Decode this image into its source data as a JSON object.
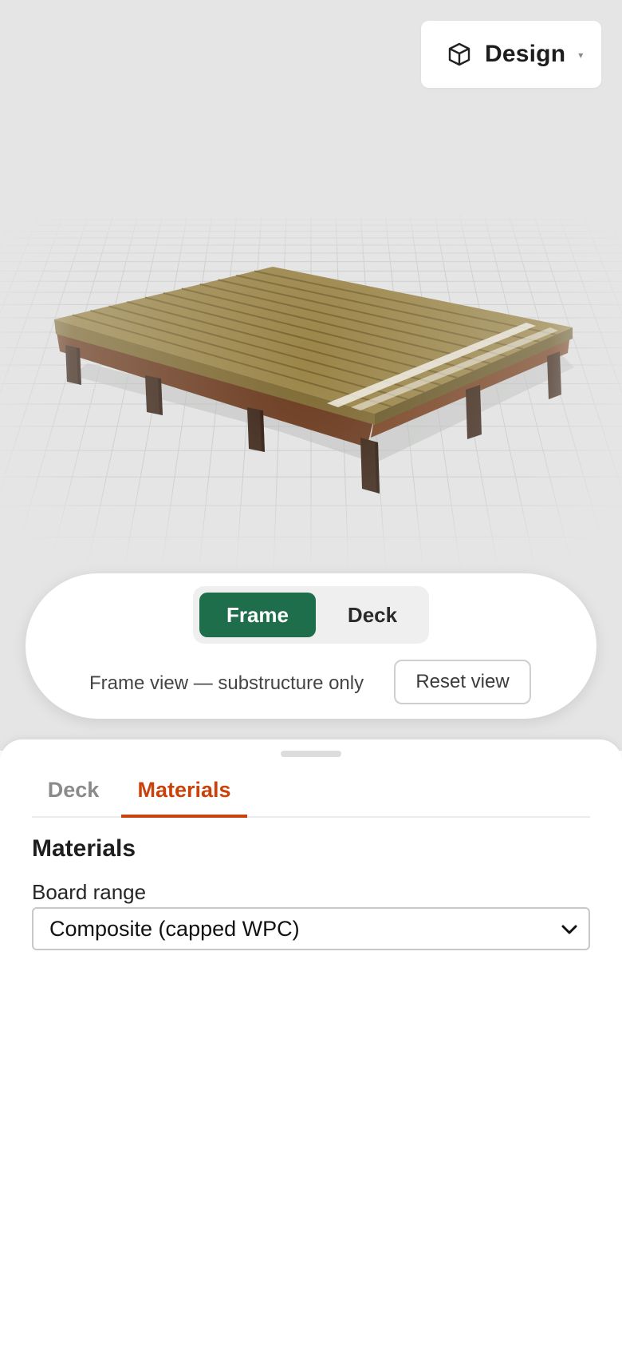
{
  "header": {
    "view_menu": {
      "label": "Design",
      "icon": "cube-icon",
      "caret": "▾"
    }
  },
  "viewer": {
    "scene": "3d-deck-frame-render",
    "segmented": {
      "options": [
        "Frame",
        "Deck"
      ],
      "selected": "Frame"
    },
    "status_text": "Frame view — substructure only",
    "reset_label": "Reset view"
  },
  "sheet": {
    "tabs": [
      {
        "label": "Deck",
        "active": false
      },
      {
        "label": "Materials",
        "active": true
      }
    ],
    "section_title": "Materials",
    "board_range": {
      "label": "Board range",
      "value": "Composite (capped WPC)"
    }
  },
  "colors": {
    "accent_green": "#1e6e4c",
    "active_tab": "#c9420b",
    "viewport_bg": "#e4e5e4",
    "board": "#9b8548",
    "post": "#3b2416"
  }
}
